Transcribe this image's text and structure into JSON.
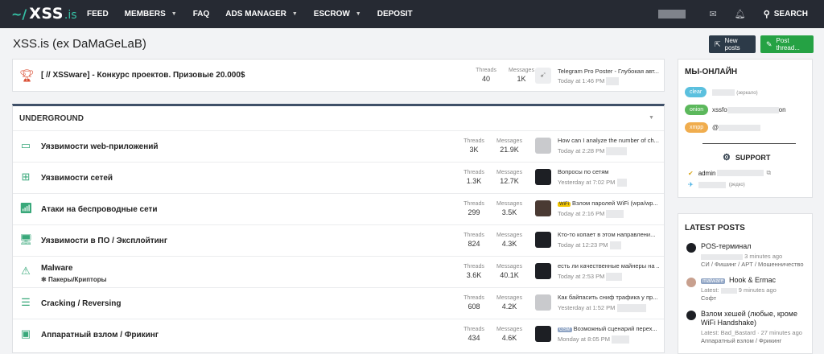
{
  "header": {
    "logo_prefix": "~/",
    "logo_name": "XSS",
    "logo_suffix": ".is",
    "nav": [
      {
        "label": "FEED"
      },
      {
        "label": "MEMBERS"
      },
      {
        "label": "FAQ"
      },
      {
        "label": "ADS MANAGER"
      },
      {
        "label": "ESCROW"
      },
      {
        "label": "DEPOSIT"
      }
    ],
    "search_label": "SEARCH",
    "icons": {
      "mail": "mail-icon",
      "bell": "bell-icon",
      "search": "search-icon"
    }
  },
  "page": {
    "title": "XSS.is (ex DaMaGeLaB)",
    "new_posts": "New posts",
    "post_thread": "Post thread..."
  },
  "promo": {
    "title": "[ // XSSware] - Конкурс проектов. Призовые 20.000$",
    "threads_label": "Threads",
    "threads": "40",
    "messages_label": "Messages",
    "messages": "1K",
    "latest_title": "Telegram Pro Poster - Глубокая авт...",
    "latest_date": "Today at 1:46 PM"
  },
  "underground": {
    "heading": "UNDERGROUND",
    "threads_label": "Threads",
    "messages_label": "Messages",
    "forums": [
      {
        "title": "Уязвимости web-приложений",
        "threads": "3K",
        "messages": "21.9K",
        "latest": "How can I analyze the number of ch...",
        "date": "Today at 2:28 PM",
        "icon": "web-vuln-icon"
      },
      {
        "title": "Уязвимости сетей",
        "threads": "1.3K",
        "messages": "12.7K",
        "latest": "Вопросы по сетям",
        "date": "Yesterday at 7:02 PM",
        "icon": "network-icon"
      },
      {
        "title": "Атаки на беспроводные сети",
        "threads": "299",
        "messages": "3.5K",
        "prefix": "WiFi",
        "latest": "Взлом паролей WiFi (wpa/wp...",
        "date": "Today at 2:16 PM",
        "icon": "wireless-icon"
      },
      {
        "title": "Уязвимости в ПО / Эксплойтинг",
        "threads": "824",
        "messages": "4.3K",
        "latest": "Кто-то копает в этом направлени...",
        "date": "Today at 12:23 PM",
        "icon": "software-icon"
      },
      {
        "title": "Malware",
        "subforum": "Пакеры/Крипторы",
        "threads": "3.6K",
        "messages": "40.1K",
        "latest": "есть ли качественные майнеры на ...",
        "date": "Today at 2:53 PM",
        "icon": "malware-icon"
      },
      {
        "title": "Cracking / Reversing",
        "threads": "608",
        "messages": "4.2K",
        "latest": "Как байпасить сниф трафика у пр...",
        "date": "Yesterday at 1:52 PM",
        "icon": "cracking-icon"
      },
      {
        "title": "Аппаратный взлом / Фрикинг",
        "threads": "434",
        "messages": "4.6K",
        "prefix": "GSM",
        "latest": "Возможный сценарий перех...",
        "date": "Monday at 8:05 PM",
        "icon": "hardware-icon"
      }
    ]
  },
  "online": {
    "heading": "МЫ-ОНЛАЙН",
    "tags": [
      {
        "label": "clear",
        "color": "#5bc0de",
        "value": "",
        "note": "(зеркало)"
      },
      {
        "label": "onion",
        "color": "#5cb85c",
        "value": "xssfo",
        "value_end": "on"
      },
      {
        "label": "xmpp",
        "color": "#f0ad4e",
        "value": "@"
      }
    ],
    "support_label": "SUPPORT",
    "admin": "admin",
    "telegram_note": "(редко)"
  },
  "latest_posts": {
    "heading": "LATEST POSTS",
    "items": [
      {
        "title": "POS-терминал",
        "meta_time": "3 minutes ago",
        "category": "СИ / Фишинг / APT / Мошенничество"
      },
      {
        "prefix": "malware",
        "title": "Hook & Ermac",
        "meta_label": "Latest:",
        "meta_time": "9 minutes ago",
        "category": "Софт"
      },
      {
        "title": "Взлом хешей (любые, кроме WiFi Handshake)",
        "meta": "Latest: Bad_Bastard · 27 minutes ago",
        "category": "Аппаратный взлом / Фрикинг"
      }
    ]
  },
  "colors": {
    "accent": "#35c0a5",
    "topbar": "#262a33",
    "section_border": "#3f5068",
    "new_posts_btn": "#2c3a48",
    "post_thread_btn": "#25a244"
  }
}
